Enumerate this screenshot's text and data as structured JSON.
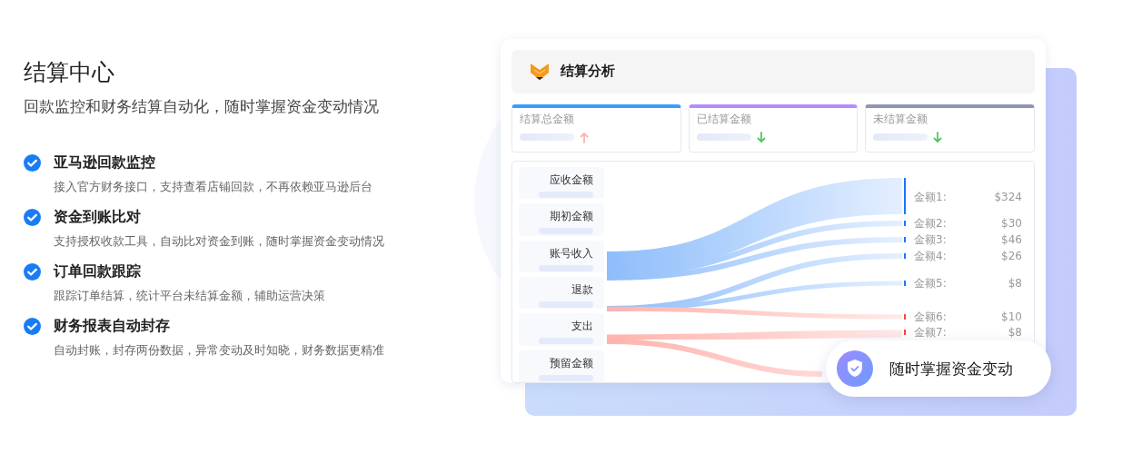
{
  "heading": {
    "title": "结算中心",
    "subtitle": "回款监控和财务结算自动化，随时掌握资金变动情况"
  },
  "features": [
    {
      "title": "亚马逊回款监控",
      "description": "接入官方财务接口，支持查看店铺回款，不再依赖亚马逊后台"
    },
    {
      "title": "资金到账比对",
      "description": "支持授权收款工具，自动比对资金到账，随时掌握资金变动情况"
    },
    {
      "title": "订单回款跟踪",
      "description": "跟踪订单结算，统计平台未结算金额，辅助运营决策"
    },
    {
      "title": "财务报表自动封存",
      "description": "自动封账，封存两份数据，异常变动及时知晓，财务数据更精准"
    }
  ],
  "panel": {
    "title": "结算分析",
    "stat_cards": [
      {
        "label": "结算总金额",
        "color": "#3b9cff",
        "kind": "up"
      },
      {
        "label": "已结算金额",
        "color": "#b38cff",
        "kind": "down"
      },
      {
        "label": "未结算金额",
        "color": "#8f96b3",
        "kind": "down"
      }
    ],
    "sources": [
      "应收金额",
      "期初金额",
      "账号收入",
      "退款",
      "支出",
      "预留金额"
    ],
    "amounts": [
      {
        "label": "金额1:",
        "value": "$324",
        "color": "#1677ff"
      },
      {
        "label": "金额2:",
        "value": "$30",
        "color": "#1677ff"
      },
      {
        "label": "金额3:",
        "value": "$46",
        "color": "#1677ff"
      },
      {
        "label": "金额4:",
        "value": "$26",
        "color": "#1677ff"
      },
      {
        "label": "金额5:",
        "value": "$8",
        "color": "#1677ff"
      },
      {
        "label": "金额6:",
        "value": "$10",
        "color": "#f04848"
      },
      {
        "label": "金额7:",
        "value": "$8",
        "color": "#f04848"
      }
    ]
  },
  "badge": {
    "text": "随时掌握资金变动"
  }
}
